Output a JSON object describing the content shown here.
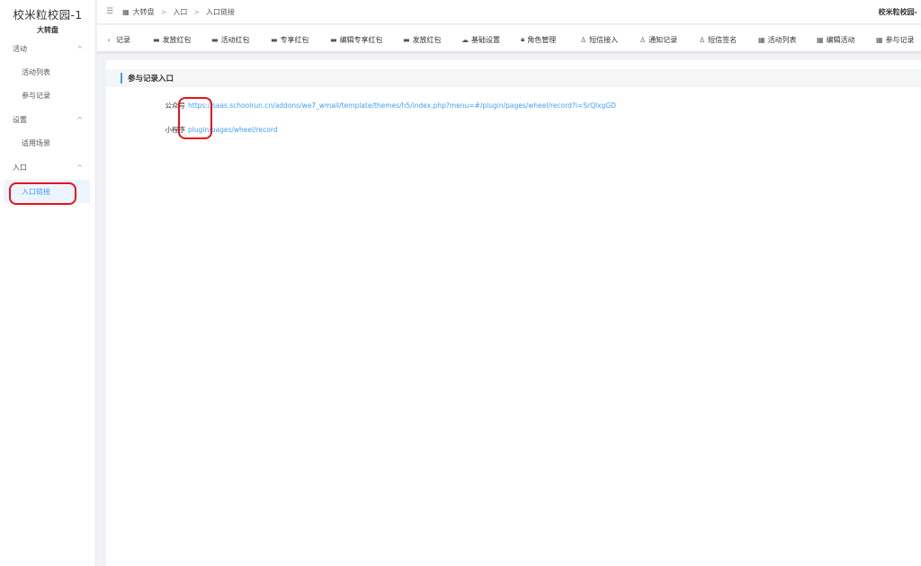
{
  "sidebar": {
    "app_title": "校米粒校园-1",
    "app_subtitle": "大转盘",
    "groups": [
      {
        "label": "活动",
        "items": [
          "活动列表",
          "参与记录"
        ]
      },
      {
        "label": "设置",
        "items": [
          "适用场景"
        ]
      },
      {
        "label": "入口",
        "items": [
          "入口链接"
        ]
      }
    ],
    "active_item": "入口链接"
  },
  "topbar": {
    "breadcrumb": [
      "大转盘",
      "入口",
      "入口链接"
    ],
    "account_name": "校米粒校园-"
  },
  "tabs": [
    {
      "label": "记录",
      "icon": "none"
    },
    {
      "label": "发放红包",
      "icon": "box-icon"
    },
    {
      "label": "活动红包",
      "icon": "box-icon"
    },
    {
      "label": "专享红包",
      "icon": "box-icon"
    },
    {
      "label": "编辑专享红包",
      "icon": "box-icon"
    },
    {
      "label": "发放红包",
      "icon": "box-icon"
    },
    {
      "label": "基础设置",
      "icon": "cloud-icon"
    },
    {
      "label": "角色管理",
      "icon": "lock-icon"
    },
    {
      "label": "短信接入",
      "icon": "user-icon"
    },
    {
      "label": "通知记录",
      "icon": "user-icon"
    },
    {
      "label": "短信签名",
      "icon": "user-icon"
    },
    {
      "label": "活动列表",
      "icon": "grid-icon"
    },
    {
      "label": "编辑活动",
      "icon": "grid-icon"
    },
    {
      "label": "参与记录",
      "icon": "grid-icon"
    }
  ],
  "panel": {
    "title": "参与记录入口",
    "entries": [
      {
        "label": "公众号",
        "value": "https://saas.schoolrun.cn/addons/we7_wmall/template/themes/h5/index.php?menu=#/plugin/pages/wheel/record?i=SrQlxgGD"
      },
      {
        "label": "小程序",
        "value": "plugin/pages/wheel/record"
      }
    ]
  },
  "colors": {
    "accent": "#409eff",
    "highlight": "#e8121b"
  }
}
